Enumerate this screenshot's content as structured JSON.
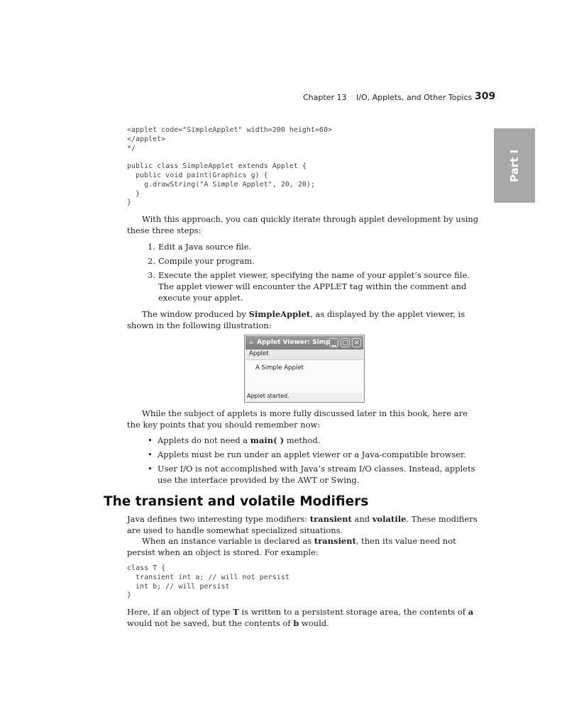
{
  "header": {
    "chapter": "Chapter 13",
    "topic": "I/O, Applets, and Other Topics",
    "page_number": "309"
  },
  "side_tab": {
    "label": "Part I"
  },
  "code1": "<applet code=\"SimpleApplet\" width=200 height=60>\n</applet>\n*/\n\npublic class SimpleApplet extends Applet {\n  public void paint(Graphics g) {\n    g.drawString(\"A Simple Applet\", 20, 20);\n  }\n}",
  "para1": "With this approach, you can quickly iterate through applet development by using these three steps:",
  "steps": [
    {
      "num": "1.",
      "text": "Edit a Java source file."
    },
    {
      "num": "2.",
      "text": "Compile your program."
    },
    {
      "num": "3.",
      "text": "Execute the applet viewer, specifying the name of your applet’s source file. The applet viewer will encounter the APPLET tag within the comment and execute your applet."
    }
  ],
  "para2": {
    "before": "The window produced by ",
    "bold": "SimpleApplet",
    "after": ", as displayed by the applet viewer, is shown in the following illustration:"
  },
  "applet_window": {
    "title": "Applet Viewer: Simp...",
    "icon": "☕",
    "minimize": "▁",
    "maximize": "▢",
    "close": "✕",
    "menu": "Applet",
    "canvas_text": "A Simple Applet",
    "status": "Applet started."
  },
  "para3": "While the subject of applets is more fully discussed later in this book, here are the key points that you should remember now:",
  "bullets": {
    "b1_before": "Applets do not need a ",
    "b1_bold": "main( )",
    "b1_after": " method.",
    "b2": "Applets must be run under an applet viewer or a Java-compatible browser.",
    "b3": "User I/O is not accomplished with Java’s stream I/O classes. Instead, applets use the interface provided by the AWT or Swing."
  },
  "section_heading": "The transient and volatile Modifiers",
  "para4": {
    "t1": "Java defines two interesting type modifiers: ",
    "b1": "transient",
    "t2": " and ",
    "b2": "volatile",
    "t3": ". These modifiers are used to handle somewhat specialized situations."
  },
  "para5": {
    "t1": "When an instance variable is declared as ",
    "b1": "transient",
    "t2": ", then its value need not persist when an object is stored. For example:"
  },
  "code2": "class T {\n  transient int a; // will not persist\n  int b; // will persist\n}",
  "para6": {
    "t1": "Here, if an object of type ",
    "b1": "T",
    "t2": " is written to a persistent storage area, the contents of ",
    "b2": "a",
    "t3": " would not be saved, but the contents of ",
    "b3": "b",
    "t4": " would."
  }
}
